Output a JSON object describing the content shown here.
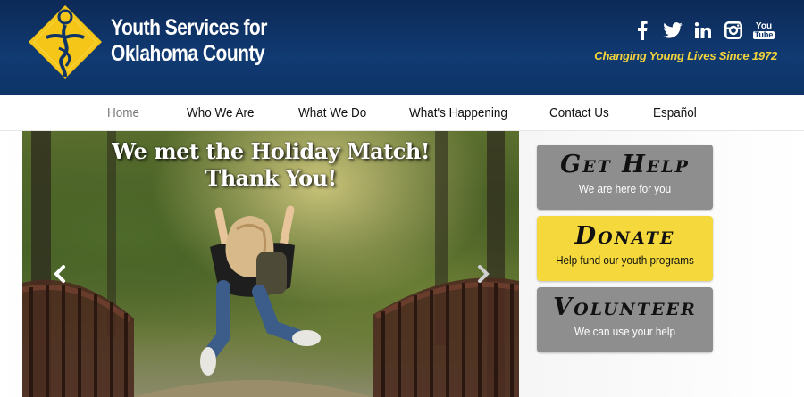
{
  "header": {
    "org_name_line1": "Youth Services for",
    "org_name_line2": "Oklahoma County",
    "tagline": "Changing Young Lives Since 1972",
    "social": [
      "facebook-icon",
      "twitter-icon",
      "linkedin-icon",
      "instagram-icon",
      "youtube-icon"
    ],
    "youtube_label_1": "You",
    "youtube_label_2": "Tube",
    "brand_color": "#103a72",
    "accent_color": "#f5d93c"
  },
  "nav": {
    "items": [
      {
        "label": "Home",
        "active": true
      },
      {
        "label": "Who We Are"
      },
      {
        "label": "What We Do"
      },
      {
        "label": "What's Happening"
      },
      {
        "label": "Contact Us"
      },
      {
        "label": "Español"
      }
    ]
  },
  "slider": {
    "caption_line1": "We met the Holiday Match!",
    "caption_line2": "Thank You!"
  },
  "actions": [
    {
      "title": "Get Help",
      "subtitle": "We are here for you"
    },
    {
      "title": "Donate",
      "subtitle": "Help fund our youth programs"
    },
    {
      "title": "Volunteer",
      "subtitle": "We can use your help"
    }
  ]
}
